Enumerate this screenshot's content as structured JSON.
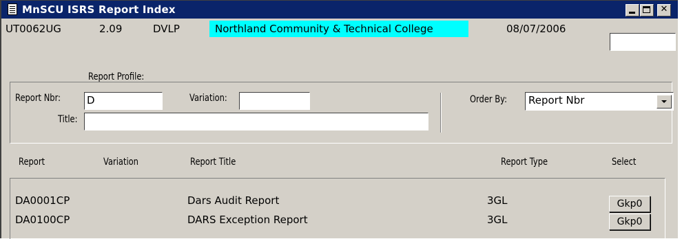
{
  "window": {
    "title": "MnSCU ISRS Report Index"
  },
  "info": {
    "program": "UT0062UG",
    "version": "2.09",
    "env": "DVLP",
    "college": "Northland Community & Technical College",
    "date": "08/07/2006",
    "college_bg": "#00ffff"
  },
  "filter": {
    "group_label": "Report Profile:",
    "report_nbr_label": "Report Nbr:",
    "report_nbr_value": "D",
    "variation_label": "Variation:",
    "variation_value": "",
    "title_label": "Title:",
    "title_value": "",
    "order_by_label": "Order By:",
    "order_by_value": "Report Nbr"
  },
  "table": {
    "headers": [
      "Report",
      "Variation",
      "Report Title",
      "Report Type",
      "Select"
    ],
    "rows": [
      {
        "report": "DA0001CP",
        "variation": "",
        "title": "Dars Audit Report",
        "type": "3GL",
        "select": "Gkp0"
      },
      {
        "report": "DA0100CP",
        "variation": "",
        "title": "DARS Exception Report",
        "type": "3GL",
        "select": "Gkp0"
      }
    ]
  },
  "colors": {
    "titlebar": "#0a246a",
    "window_bg": "#d4d0c8"
  }
}
